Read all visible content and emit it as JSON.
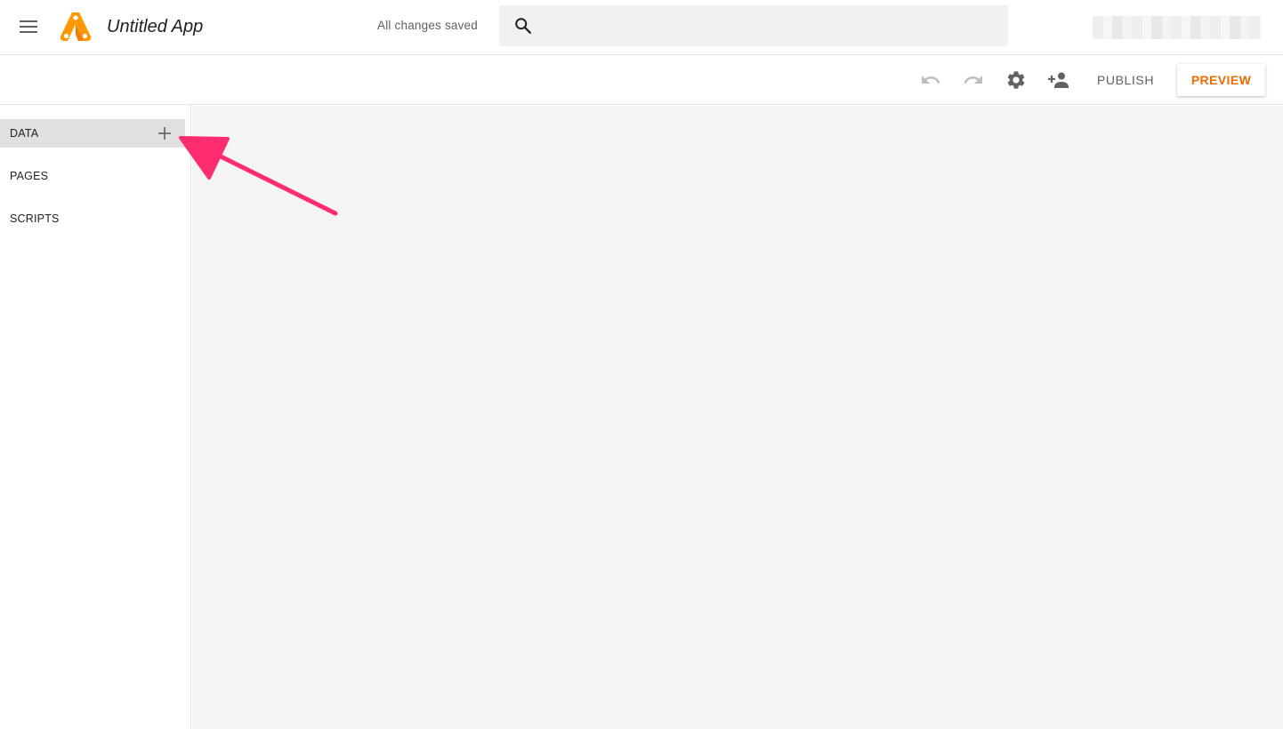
{
  "header": {
    "app_title": "Untitled App",
    "save_status": "All changes saved",
    "search": {
      "value": "",
      "placeholder": ""
    },
    "icons": {
      "menu": "menu-icon",
      "logo": "app-maker-logo",
      "search": "search-icon"
    }
  },
  "toolbar": {
    "icons": [
      "undo-icon",
      "redo-icon",
      "gear-icon",
      "add-person-icon"
    ],
    "publish_label": "PUBLISH",
    "preview_label": "PREVIEW"
  },
  "sidebar": {
    "items": [
      {
        "label": "DATA",
        "active": true,
        "action_icon": "plus-icon"
      },
      {
        "label": "PAGES",
        "active": false
      },
      {
        "label": "SCRIPTS",
        "active": false
      }
    ]
  },
  "colors": {
    "accent": "#ef6c00",
    "logo_primary": "#ff9800",
    "logo_secondary": "#f57c00",
    "annotation": "#ff2d6f",
    "canvas_bg": "#f4f4f4",
    "active_nav_bg": "#e0e0e0",
    "icon_gray": "#616161",
    "icon_disabled": "#bdbdbd"
  }
}
